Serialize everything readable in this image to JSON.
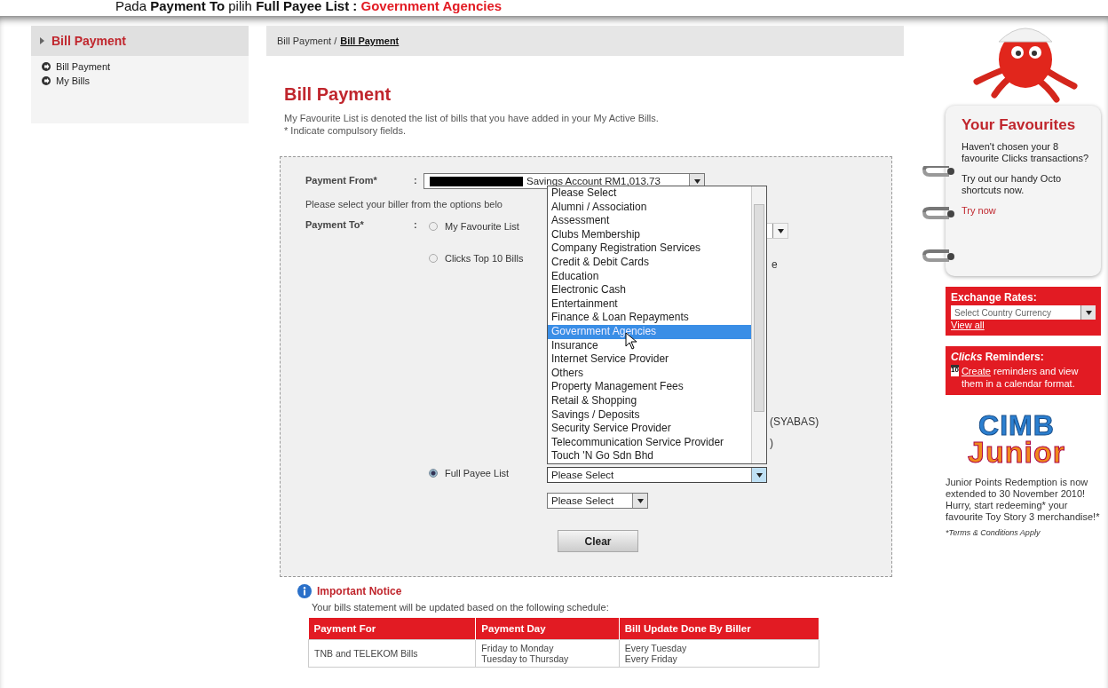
{
  "caption": "Pada **Payment To** pilih **Full Payee List :**",
  "caption_highlight": "Government Agencies",
  "sidebar": {
    "title": "Bill Payment",
    "items": [
      {
        "label": "Bill Payment"
      },
      {
        "label": "My Bills"
      }
    ]
  },
  "breadcrumb": {
    "parent": "Bill Payment /",
    "current": "Bill Payment"
  },
  "page_title": "Bill Payment",
  "description": [
    "My Favourite List is denoted the list of bills that you have added in your My Active Bills.",
    "* Indicate compulsory fields."
  ],
  "form": {
    "payment_from": {
      "label": "Payment From*",
      "separator": ":",
      "value": "Savings Account RM1,013.73"
    },
    "hint": "Please select your biller from the options belo",
    "payment_to": {
      "label": "Payment To*",
      "separator": ":"
    },
    "options": [
      {
        "label": "My Favourite List",
        "selected": false
      },
      {
        "label": "Clicks Top 10 Bills",
        "selected": false
      },
      {
        "label": "Full Payee List",
        "selected": true
      }
    ],
    "hidden_fragments": [
      "e",
      "(SYABAS)",
      ")"
    ],
    "category_select": {
      "value": "Please Select"
    },
    "biller_select": {
      "value": "Please Select"
    },
    "dropdown": [
      {
        "label": "Please Select",
        "selected": false
      },
      {
        "label": "Alumni / Association",
        "selected": false
      },
      {
        "label": "Assessment",
        "selected": false
      },
      {
        "label": "Clubs Membership",
        "selected": false
      },
      {
        "label": "Company Registration Services",
        "selected": false
      },
      {
        "label": "Credit & Debit Cards",
        "selected": false
      },
      {
        "label": "Education",
        "selected": false
      },
      {
        "label": "Electronic Cash",
        "selected": false
      },
      {
        "label": "Entertainment",
        "selected": false
      },
      {
        "label": "Finance & Loan Repayments",
        "selected": false
      },
      {
        "label": "Government Agencies",
        "selected": true
      },
      {
        "label": "Insurance",
        "selected": false
      },
      {
        "label": "Internet Service Provider",
        "selected": false
      },
      {
        "label": "Others",
        "selected": false
      },
      {
        "label": "Property Management Fees",
        "selected": false
      },
      {
        "label": "Retail & Shopping",
        "selected": false
      },
      {
        "label": "Savings / Deposits",
        "selected": false
      },
      {
        "label": "Security Service Provider",
        "selected": false
      },
      {
        "label": "Telecommunication Service Provider",
        "selected": false
      },
      {
        "label": "Touch 'N Go Sdn Bhd",
        "selected": false
      }
    ],
    "clear_button": "Clear"
  },
  "notice": {
    "title": "Important Notice",
    "text": "Your bills statement will be updated based on the following schedule:",
    "table": {
      "columns": [
        "Payment For",
        "Payment Day",
        "Bill Update Done By Biller"
      ],
      "rows": [
        [
          "TNB and TELEKOM Bills",
          "Friday to Monday\nTuesday to Thursday",
          "Every Tuesday\nEvery Friday"
        ]
      ]
    }
  },
  "favourites": {
    "title": "Your Favourites",
    "text1": "Haven't chosen your 8 favourite Clicks transactions?",
    "text2": "Try out our handy Octo shortcuts now.",
    "link": "Try now"
  },
  "exchange": {
    "title": "Exchange Rates:",
    "select": "Select Country Currency",
    "link": "View all"
  },
  "reminders": {
    "title_em": "Clicks",
    "title": "Reminders:",
    "calendar": "10",
    "link": "Create",
    "text": "reminders and view them in a calendar format."
  },
  "junior": {
    "logo_top": "CIMB",
    "logo_bottom": "Junior",
    "text": "Junior Points Redemption is now extended to 30 November 2010! Hurry, start redeeming* your favourite Toy Story 3 merchandise!*",
    "terms": "*Terms & Conditions Apply"
  }
}
